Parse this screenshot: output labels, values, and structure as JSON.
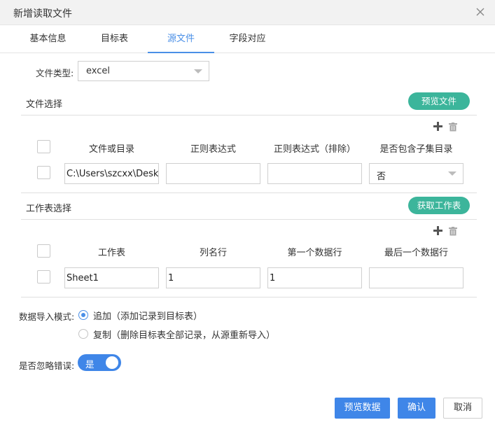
{
  "dialog": {
    "title": "新增读取文件",
    "close_icon": "close-icon"
  },
  "tabs": [
    {
      "label": "基本信息",
      "active": false
    },
    {
      "label": "目标表",
      "active": false
    },
    {
      "label": "源文件",
      "active": true
    },
    {
      "label": "字段对应",
      "active": false
    }
  ],
  "file_type": {
    "label": "文件类型:",
    "value": "excel"
  },
  "file_section": {
    "title": "文件选择",
    "preview_button": "预览文件",
    "columns": [
      "文件或目录",
      "正则表达式",
      "正则表达式（排除）",
      "是否包含子集目录"
    ],
    "row": {
      "path": "C:\\Users\\szcxx\\Deskt",
      "regex": "",
      "regex_exclude": "",
      "include_subdir": "否"
    }
  },
  "sheet_section": {
    "title": "工作表选择",
    "fetch_button": "获取工作表",
    "columns": [
      "工作表",
      "列名行",
      "第一个数据行",
      "最后一个数据行"
    ],
    "row": {
      "sheet": "Sheet1",
      "header_row": "1",
      "first_data_row": "1",
      "last_data_row": ""
    }
  },
  "import_mode": {
    "label": "数据导入模式:",
    "options": [
      {
        "text": "追加（添加记录到目标表）",
        "selected": true
      },
      {
        "text": "复制（删除目标表全部记录，从源重新导入）",
        "selected": false
      }
    ]
  },
  "ignore_errors": {
    "label": "是否忽略错误:",
    "toggle_text": "是",
    "on": true
  },
  "footer": {
    "preview_data": "预览数据",
    "confirm": "确认",
    "cancel": "取消"
  },
  "colors": {
    "accent_blue": "#3f86e8",
    "tab_active": "#4a8fe7",
    "green": "#3cb59b"
  }
}
